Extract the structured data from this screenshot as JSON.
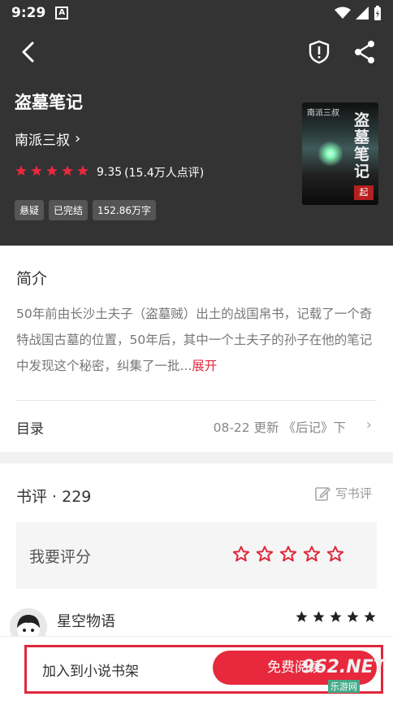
{
  "status_bar": {
    "time": "9:29",
    "notif_icon": "A"
  },
  "book": {
    "title": "盗墓笔记",
    "author": "南派三叔",
    "rating": "9.35",
    "rating_count": "(15.4万人点评)",
    "stars": 5,
    "tags": [
      "悬疑",
      "已完结",
      "152.86万字"
    ],
    "cover": {
      "author": "南派三叔",
      "title": "盗墓笔记",
      "seal": "起"
    }
  },
  "intro": {
    "label": "简介",
    "text": "50年前由长沙土夫子（盗墓贼）出土的战国帛书，记载了一个奇特战国古墓的位置，50年后，其中一个土夫子的孙子在他的笔记中发现这个秘密，纠集了一批...",
    "expand": "展开"
  },
  "toc": {
    "label": "目录",
    "info": "08-22  更新  《后记》下",
    "chevron": "›"
  },
  "reviews": {
    "title": "书评 · 229",
    "write_label": "写书评",
    "rate_prompt": "我要评分",
    "rate_stars": 5,
    "first_review": {
      "name": "星空物语",
      "stars": 5
    }
  },
  "bottom": {
    "add_shelf": "加入到小说书架",
    "read": "免费阅读"
  },
  "watermark": {
    "text": "962.NET",
    "sub": "乐游网"
  },
  "colors": {
    "accent": "#e8283c",
    "header_bg": "#333333"
  },
  "icons": {
    "back": "chevron-left-icon",
    "shield": "shield-alert-icon",
    "share": "share-icon",
    "edit": "edit-icon"
  }
}
